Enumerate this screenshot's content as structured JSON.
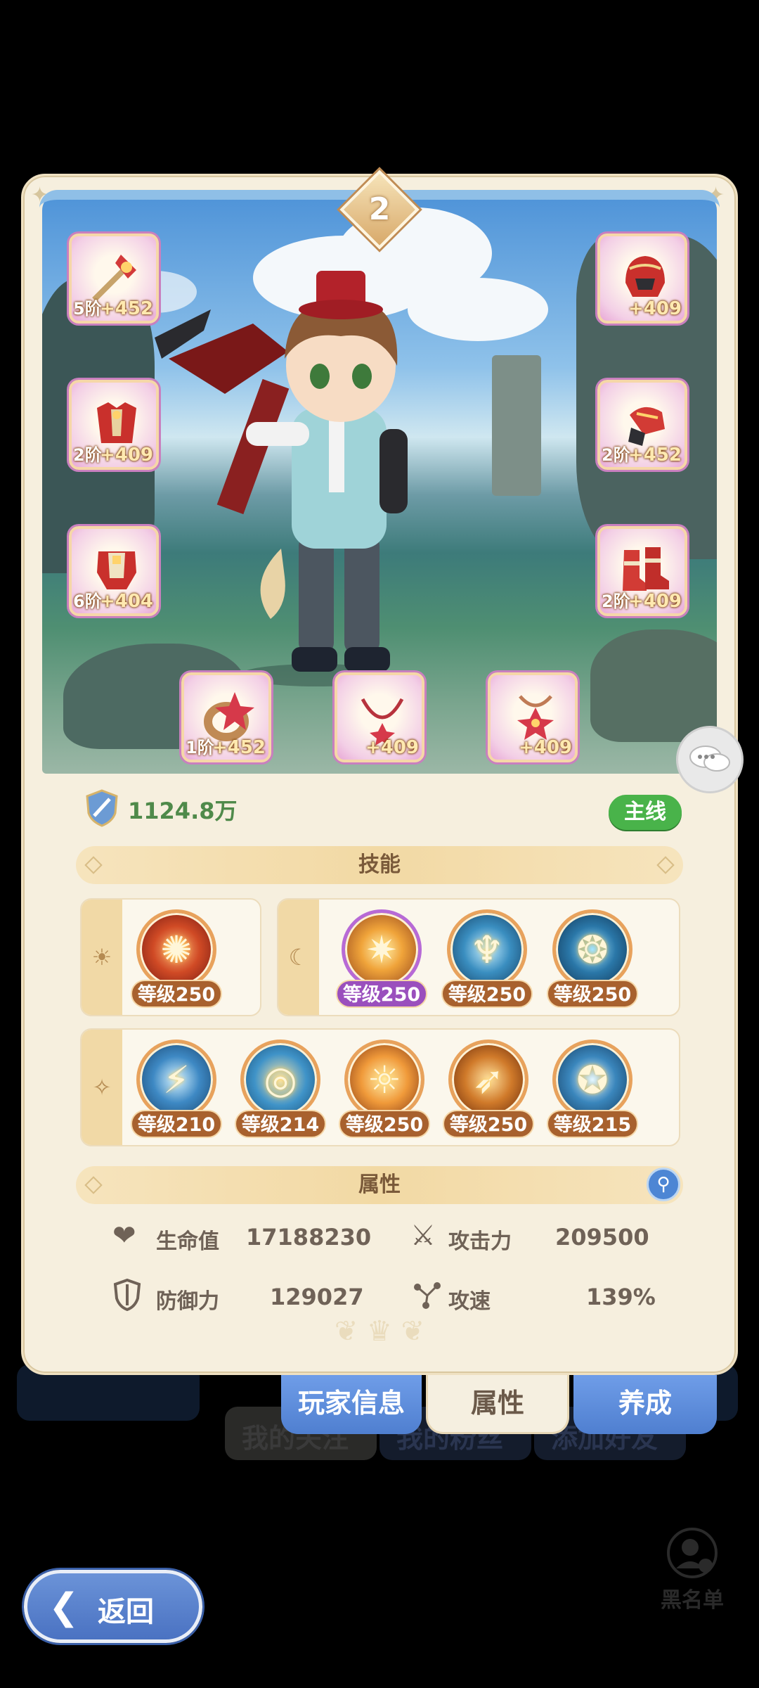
{
  "background": {
    "tabs_behind": [
      "我的关注",
      "我的粉丝",
      "添加好友"
    ],
    "blacklist_label": "黑名单"
  },
  "panel": {
    "grade": "2",
    "power": "1124.8万",
    "mainline_badge": "主线"
  },
  "equipment": [
    {
      "slot": "weapon",
      "icon": "staff-icon",
      "stage": "5阶",
      "plus": "+452"
    },
    {
      "slot": "helmet",
      "icon": "helmet-icon",
      "stage": "",
      "plus": "+409"
    },
    {
      "slot": "chest",
      "icon": "armor-icon",
      "stage": "2阶",
      "plus": "+409"
    },
    {
      "slot": "gloves",
      "icon": "gauntlet-icon",
      "stage": "2阶",
      "plus": "+452"
    },
    {
      "slot": "legs",
      "icon": "leg-armor-icon",
      "stage": "6阶",
      "plus": "+404"
    },
    {
      "slot": "boots",
      "icon": "boots-icon",
      "stage": "2阶",
      "plus": "+409"
    },
    {
      "slot": "ring",
      "icon": "ring-icon",
      "stage": "1阶",
      "plus": "+452"
    },
    {
      "slot": "necklace",
      "icon": "necklace-icon",
      "stage": "",
      "plus": "+409"
    },
    {
      "slot": "amulet",
      "icon": "amulet-icon",
      "stage": "",
      "plus": "+409"
    }
  ],
  "skills_section": {
    "title": "技能",
    "sun_group": {
      "icon": "sun-icon",
      "skills": [
        {
          "level": "等级250",
          "color": "#c2431f"
        }
      ]
    },
    "moon_group": {
      "icon": "moon-icon",
      "skills": [
        {
          "level": "等级250",
          "color": "#d8902a",
          "variant": "purple"
        },
        {
          "level": "等级250",
          "color": "#2d6f9a"
        },
        {
          "level": "等级250",
          "color": "#1f5a86"
        }
      ]
    },
    "star_group": {
      "icon": "star-icon",
      "skills": [
        {
          "level": "等级210",
          "color": "#2b6ea8"
        },
        {
          "level": "等级214",
          "color": "#2f7fb3"
        },
        {
          "level": "等级250",
          "color": "#d0782a"
        },
        {
          "level": "等级250",
          "color": "#c86a25"
        },
        {
          "level": "等级215",
          "color": "#2d78b0"
        }
      ]
    }
  },
  "attributes_section": {
    "title": "属性",
    "hp_label": "生命值",
    "hp_value": "17188230",
    "atk_label": "攻击力",
    "atk_value": "209500",
    "def_label": "防御力",
    "def_value": "129027",
    "spd_label": "攻速",
    "spd_value": "139%"
  },
  "tabs": {
    "player_info": "玩家信息",
    "attributes": "属性",
    "develop": "养成"
  },
  "back_label": "返回",
  "colors": {
    "panel_bg": "#f6efde",
    "accent_blue": "#4f7fd0",
    "mainline_green": "#49b34a",
    "power_green": "#4f8a4a"
  }
}
